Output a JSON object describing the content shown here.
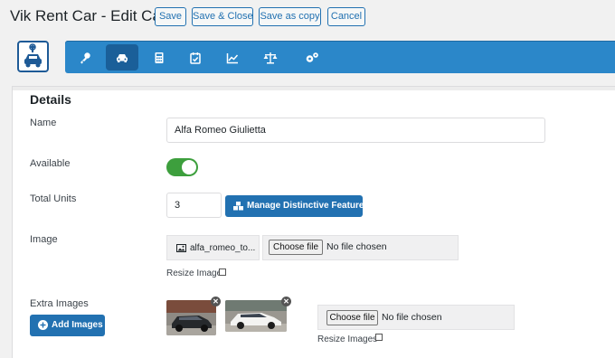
{
  "header": {
    "title": "Vik Rent Car - Edit Car",
    "buttons": {
      "save": "Save",
      "save_close": "Save & Close",
      "save_copy": "Save as copy",
      "cancel": "Cancel"
    }
  },
  "toolbar": {
    "tabs": [
      {
        "icon": "key-icon",
        "active": false
      },
      {
        "icon": "car-icon",
        "active": true
      },
      {
        "icon": "calculator-icon",
        "active": false
      },
      {
        "icon": "calendar-check-icon",
        "active": false
      },
      {
        "icon": "chart-line-icon",
        "active": false
      },
      {
        "icon": "balance-scale-icon",
        "active": false
      },
      {
        "icon": "cogs-icon",
        "active": false
      }
    ],
    "accent": "#2b87c9",
    "active_color": "#1a5f99"
  },
  "details": {
    "heading": "Details",
    "name": {
      "label": "Name",
      "value": "Alfa Romeo Giulietta"
    },
    "available": {
      "label": "Available",
      "on": true,
      "color": "#3d9f3d"
    },
    "units": {
      "label": "Total Units",
      "value": "3",
      "features_button": "Manage Distinctive Features"
    },
    "image": {
      "label": "Image",
      "current_file": "alfa_romeo_to...",
      "choose_button": "Choose file",
      "no_file": "No file chosen",
      "resize_label": "Resize Image"
    },
    "extra_images": {
      "label": "Extra Images",
      "add_button": "Add Images",
      "choose_button": "Choose file",
      "no_file": "No file chosen",
      "resize_label": "Resize Images",
      "thumbnails": [
        {
          "alt": "dark car"
        },
        {
          "alt": "white car"
        }
      ]
    }
  }
}
